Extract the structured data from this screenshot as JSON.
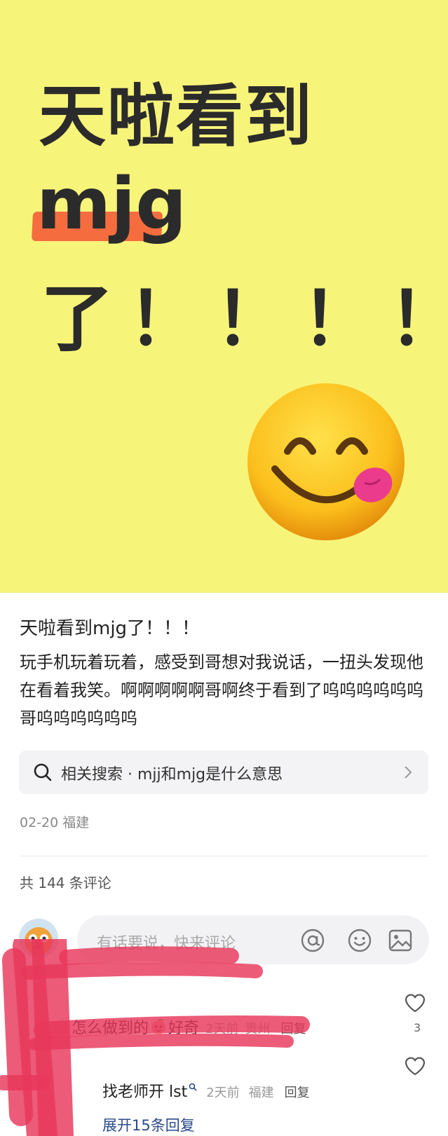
{
  "hero": {
    "line1": "天啦看到",
    "line2": "mjg",
    "line3": "了！！！！"
  },
  "post": {
    "title": "天啦看到mjg了！！！",
    "body": "玩手机玩着玩着，感受到哥想对我说话，一扭头发现他在看着我笑。啊啊啊啊啊哥啊终于看到了呜呜呜呜呜呜哥呜呜呜呜呜呜",
    "search_label": "相关搜索 · mjj和mjg是什么意思",
    "meta": "02-20 福建"
  },
  "comments": {
    "count_label": "共 144 条评论",
    "input_placeholder": "有话要说，快来评论",
    "items": [
      {
        "text_a": "怎么做到的",
        "text_b": "好奇",
        "time": "2天前",
        "location": "贵州",
        "reply": "回复",
        "likes": "3"
      },
      {
        "text": "找老师开 lst",
        "time": "2天前",
        "location": "福建",
        "reply": "回复"
      }
    ],
    "expand_label": "展开15条回复"
  },
  "icons": {
    "search": "search-icon",
    "chevron": "chevron-right-icon",
    "at": "at-icon",
    "emoji": "emoji-icon",
    "image": "image-icon",
    "heart": "heart-icon"
  },
  "colors": {
    "hero_bg": "#f7f47a",
    "highlight": "#f56d3f",
    "link": "#2a4a8a",
    "redaction": "#e8375a"
  }
}
